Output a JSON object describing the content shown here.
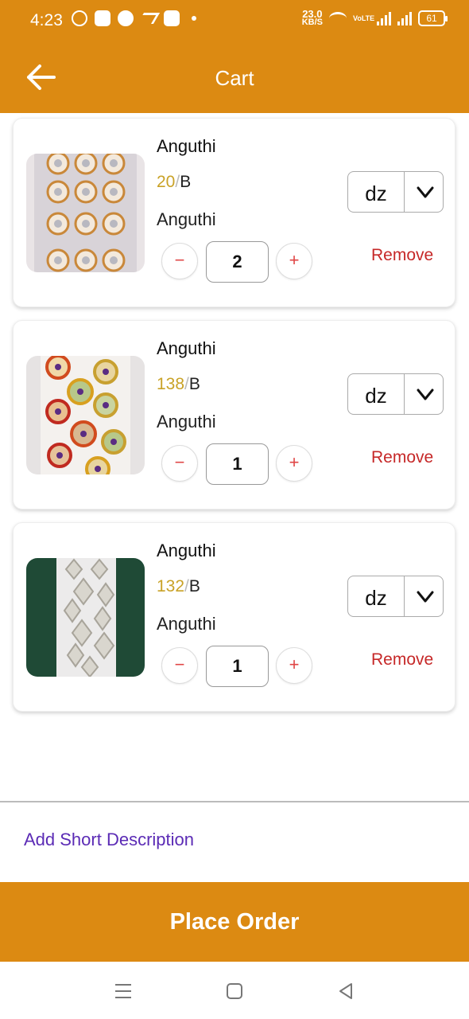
{
  "status_bar": {
    "time": "4:23",
    "speed_value": "23.0",
    "speed_unit": "KB/S",
    "volte": "VoLTE",
    "battery": "61",
    "icons": [
      "whatsapp-icon",
      "app-icon",
      "jio-icon",
      "signal-icon",
      "app-badge-icon",
      "dot-icon",
      "wifi-icon",
      "volte-icon",
      "cell-signal-icon",
      "battery-icon"
    ]
  },
  "header": {
    "title": "Cart",
    "back_icon": "back-arrow-icon"
  },
  "cart_items": [
    {
      "name": "Anguthi",
      "price": "20",
      "price_sep": "/",
      "price_unit": "B",
      "subtitle": "Anguthi",
      "quantity": "2",
      "unit": "dz",
      "remove_label": "Remove",
      "image": "gold-round-stone-stickers"
    },
    {
      "name": "Anguthi",
      "price": "138",
      "price_sep": "/",
      "price_unit": "B",
      "subtitle": "Anguthi",
      "quantity": "1",
      "unit": "dz",
      "remove_label": "Remove",
      "image": "colorful-round-stone-stickers"
    },
    {
      "name": "Anguthi",
      "price": "132",
      "price_sep": "/",
      "price_unit": "B",
      "subtitle": "Anguthi",
      "quantity": "1",
      "unit": "dz",
      "remove_label": "Remove",
      "image": "silver-diamond-stone-stickers"
    }
  ],
  "short_description_label": "Add Short Description",
  "place_order_label": "Place Order",
  "nav": {
    "icons": [
      "menu-icon",
      "home-square-icon",
      "back-triangle-icon"
    ]
  },
  "colors": {
    "accent": "#DC8A12",
    "price": "#C9A227",
    "remove": "#C62828",
    "link": "#5B2BB5"
  }
}
